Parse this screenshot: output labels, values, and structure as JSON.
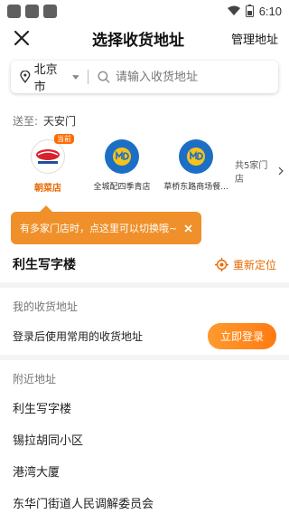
{
  "status": {
    "time": "6:10"
  },
  "header": {
    "title": "选择收货地址",
    "manage": "管理地址"
  },
  "search": {
    "city": "北京市",
    "placeholder": "请输入收货地址"
  },
  "send_to": {
    "label": "送至:",
    "place": "天安门"
  },
  "stores": [
    {
      "name": "朝菜店",
      "badge": "当前",
      "logo": "wumart-logo"
    },
    {
      "name": "全城配四季青店",
      "logo": "mdl-logo"
    },
    {
      "name": "草桥东路商场餐...",
      "logo": "mdl-logo"
    }
  ],
  "more_stores": "共5家门店",
  "tooltip": {
    "text": "有多家门店时，点这里可以切换哦~"
  },
  "current": {
    "name": "利生写字楼",
    "relocate": "重新定位"
  },
  "my_address": {
    "title": "我的收货地址",
    "text": "登录后使用常用的收货地址",
    "login": "立即登录"
  },
  "nearby": {
    "title": "附近地址",
    "items": [
      "利生写字楼",
      "锡拉胡同小区",
      "港湾大厦",
      "东华门街道人民调解委员会"
    ]
  },
  "colors": {
    "accent": "#e86a00",
    "tooltip": "#f0902a",
    "brand_blue": "#1c6fc4"
  }
}
